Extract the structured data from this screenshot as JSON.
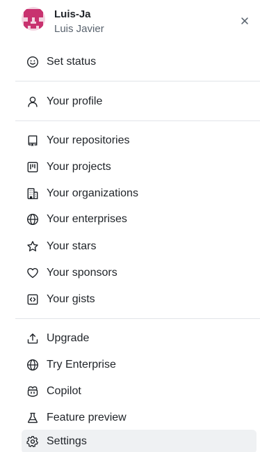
{
  "user": {
    "login": "Luis-Ja",
    "name": "Luis Javier",
    "avatar_colors": {
      "primary": "#c8326f",
      "background": "#f3d4e1"
    }
  },
  "close_label": "×",
  "menu": {
    "status": {
      "label": "Set status",
      "icon": "smiley-icon"
    },
    "profile": {
      "label": "Your profile",
      "icon": "person-icon"
    },
    "repositories": {
      "label": "Your repositories",
      "icon": "repo-icon"
    },
    "projects": {
      "label": "Your projects",
      "icon": "project-icon"
    },
    "organizations": {
      "label": "Your organizations",
      "icon": "organization-icon"
    },
    "enterprises": {
      "label": "Your enterprises",
      "icon": "globe-icon"
    },
    "stars": {
      "label": "Your stars",
      "icon": "star-icon"
    },
    "sponsors": {
      "label": "Your sponsors",
      "icon": "heart-icon"
    },
    "gists": {
      "label": "Your gists",
      "icon": "code-square-icon"
    },
    "upgrade": {
      "label": "Upgrade",
      "icon": "upload-icon"
    },
    "try_enterprise": {
      "label": "Try Enterprise",
      "icon": "globe-icon"
    },
    "copilot": {
      "label": "Copilot",
      "icon": "copilot-icon"
    },
    "feature_preview": {
      "label": "Feature preview",
      "icon": "beaker-icon"
    },
    "settings": {
      "label": "Settings",
      "icon": "gear-icon"
    }
  },
  "colors": {
    "text": "#1f2328",
    "muted": "#59636e",
    "icon": "#59636e",
    "hover": "#eff1f3",
    "divider": "#e1e4e8"
  }
}
